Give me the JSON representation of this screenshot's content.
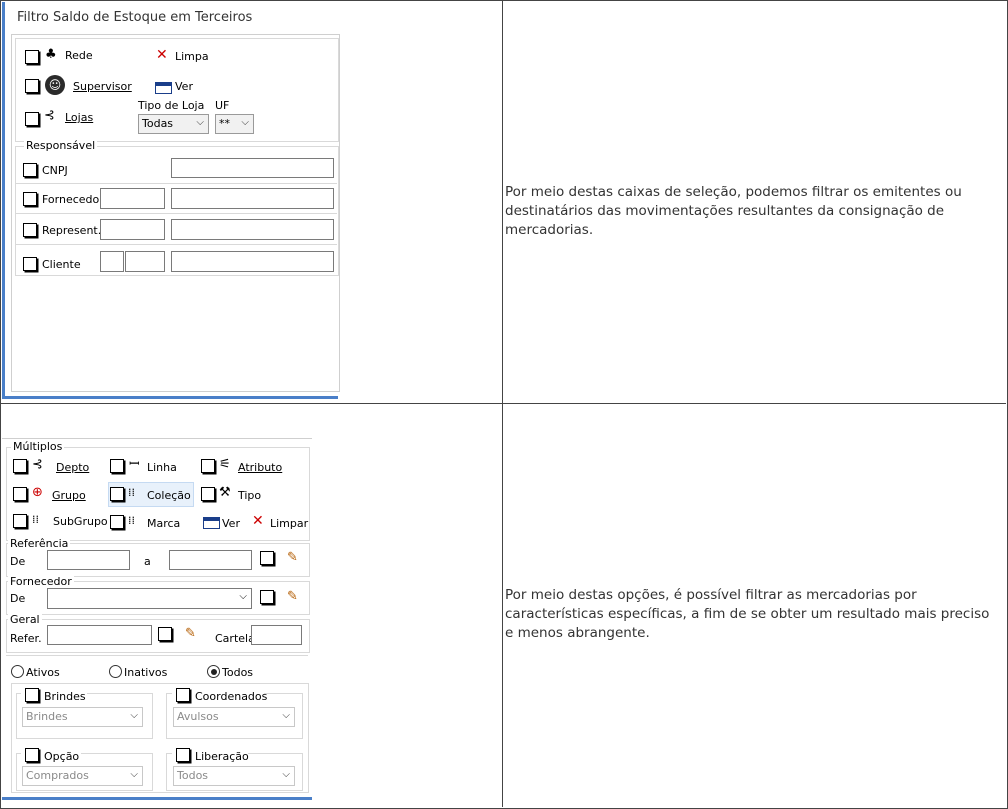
{
  "descriptions": {
    "top": "Por meio destas caixas de seleção, podemos filtrar os emitentes ou destinatários das movimentações resultantes da consignação de mercadorias.",
    "bottom": "Por meio destas opções, é possível filtrar as mercadorias por características específicas, a fim de se obter um resultado mais preciso e menos abrangente."
  },
  "filtro": {
    "title": "Filtro Saldo de Estoque em Terceiros",
    "rede": "Rede",
    "limpa": "Limpa",
    "supervisor": "Supervisor",
    "ver": "Ver",
    "lojas": "Lojas",
    "tipo_loja_label": "Tipo de Loja",
    "tipo_loja_value": "Todas",
    "uf_label": "UF",
    "uf_value": "**",
    "responsavel": "Responsável",
    "cnpj": "CNPJ",
    "fornecedor": "Fornecedor",
    "represent": "Represent.",
    "cliente": "Cliente"
  },
  "multiplos": {
    "legend": "Múltiplos",
    "depto": "Depto",
    "linha": "Linha",
    "atributo": "Atributo",
    "grupo": "Grupo",
    "colecao": "Coleção",
    "tipo": "Tipo",
    "subgrupo": "SubGrupo",
    "marca": "Marca",
    "ver": "Ver",
    "limpar": "Limpar",
    "referencia": "Referência",
    "de": "De",
    "a": "a",
    "fornecedor": "Fornecedor",
    "fornecedor_de": "De",
    "geral": "Geral",
    "refer": "Refer.",
    "cartela": "Cartela",
    "ativos": "Ativos",
    "inativos": "Inativos",
    "todos": "Todos",
    "brindes_label": "Brindes",
    "brindes_value": "Brindes",
    "coordenados_label": "Coordenados",
    "coordenados_value": "Avulsos",
    "opcao_label": "Opção",
    "opcao_value": "Comprados",
    "liberacao_label": "Liberação",
    "liberacao_value": "Todos"
  }
}
